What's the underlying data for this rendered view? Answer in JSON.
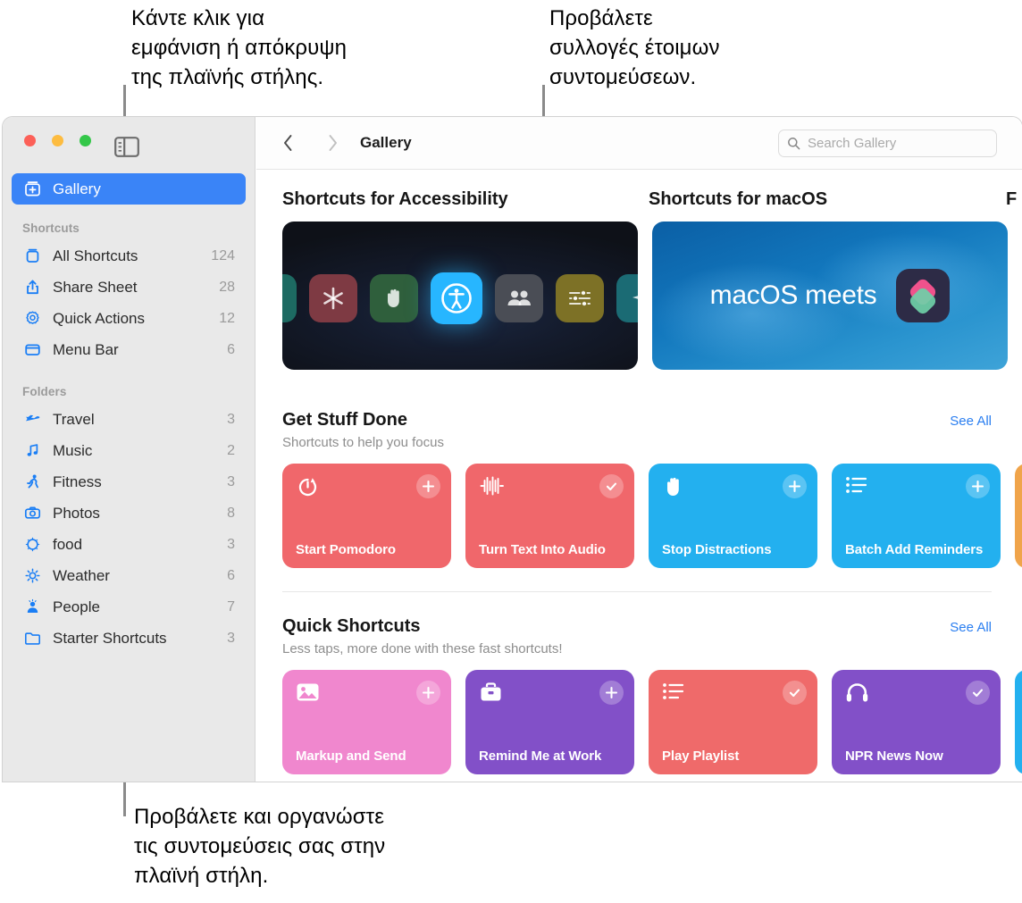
{
  "callouts": [
    {
      "id": "sidebar-toggle-callout",
      "text": "Κάντε κλικ για\nεμφάνιση ή απόκρυψη\nτης πλαϊνής στήλης."
    },
    {
      "id": "gallery-callout",
      "text": "Προβάλετε\nσυλλογές έτοιμων\nσυντομεύσεων."
    },
    {
      "id": "sidebar-callout",
      "text": "Προβάλετε και οργανώστε\nτις συντομεύσεις σας στην\nπλαϊνή στήλη."
    }
  ],
  "window": {
    "traffic_lights": [
      "close",
      "minimize",
      "zoom"
    ],
    "sidebar_toggle_icon": "sidebar-toggle-icon"
  },
  "sidebar": {
    "selected": {
      "label": "Gallery",
      "icon": "gallery-icon"
    },
    "groups": [
      {
        "label": "Shortcuts",
        "items": [
          {
            "label": "All Shortcuts",
            "count": "124",
            "icon": "shortcuts-icon"
          },
          {
            "label": "Share Sheet",
            "count": "28",
            "icon": "share-icon"
          },
          {
            "label": "Quick Actions",
            "count": "12",
            "icon": "gear-icon"
          },
          {
            "label": "Menu Bar",
            "count": "6",
            "icon": "menubar-icon"
          }
        ]
      },
      {
        "label": "Folders",
        "items": [
          {
            "label": "Travel",
            "count": "3",
            "icon": "airplane-icon"
          },
          {
            "label": "Music",
            "count": "2",
            "icon": "music-note-icon"
          },
          {
            "label": "Fitness",
            "count": "3",
            "icon": "running-person-icon"
          },
          {
            "label": "Photos",
            "count": "8",
            "icon": "camera-icon"
          },
          {
            "label": "food",
            "count": "3",
            "icon": "sparkle-circle-icon"
          },
          {
            "label": "Weather",
            "count": "6",
            "icon": "sun-icon"
          },
          {
            "label": "People",
            "count": "7",
            "icon": "person-icon"
          },
          {
            "label": "Starter Shortcuts",
            "count": "3",
            "icon": "folder-icon"
          }
        ]
      }
    ]
  },
  "toolbar": {
    "back_label": "‹",
    "forward_label": "›",
    "title": "Gallery",
    "search_placeholder": "Search Gallery",
    "search_value": ""
  },
  "banners": {
    "headings": [
      "Shortcuts for Accessibility",
      "Shortcuts for macOS",
      "F"
    ],
    "macos_text": "macOS meets",
    "accessibility_icons": [
      {
        "name": "magnifier-icon",
        "color": "#1d6a62"
      },
      {
        "name": "asterisk-icon",
        "color": "#7e3a43"
      },
      {
        "name": "hand-raised-icon",
        "color": "#2f5f3c"
      },
      {
        "name": "accessibility-icon",
        "color": "#27b6ff"
      },
      {
        "name": "people-icon",
        "color": "#4a4d55"
      },
      {
        "name": "sliders-icon",
        "color": "#7d7126"
      },
      {
        "name": "sparkles-icon",
        "color": "#1b6b74"
      }
    ]
  },
  "sections": [
    {
      "title": "Get Stuff Done",
      "subtitle": "Shortcuts to help you focus",
      "see_all": "See All",
      "cards": [
        {
          "title": "Start Pomodoro",
          "icon": "timer-icon",
          "badge": "plus",
          "color": "#f0676b"
        },
        {
          "title": "Turn Text Into Audio",
          "icon": "waveform-icon",
          "badge": "check",
          "color": "#f0676b"
        },
        {
          "title": "Stop Distractions",
          "icon": "hand-raised-icon",
          "badge": "plus",
          "color": "#23b0ef"
        },
        {
          "title": "Batch Add Reminders",
          "icon": "list-icon",
          "badge": "plus",
          "color": "#23b0ef"
        },
        {
          "title": "",
          "icon": "",
          "badge": "",
          "color": "#f0a44a"
        }
      ]
    },
    {
      "title": "Quick Shortcuts",
      "subtitle": "Less taps, more done with these fast shortcuts!",
      "see_all": "See All",
      "cards": [
        {
          "title": "Markup and Send",
          "icon": "photo-icon",
          "badge": "plus",
          "color": "#f087ce"
        },
        {
          "title": "Remind Me at Work",
          "icon": "briefcase-icon",
          "badge": "plus",
          "color": "#8250c8"
        },
        {
          "title": "Play Playlist",
          "icon": "list-icon",
          "badge": "check",
          "color": "#ef6a6a"
        },
        {
          "title": "NPR News Now",
          "icon": "headphones-icon",
          "badge": "check",
          "color": "#8250c8"
        },
        {
          "title": "",
          "icon": "",
          "badge": "",
          "color": "#23b0ef"
        }
      ]
    }
  ],
  "colors": {
    "accent": "#3a84f7",
    "link": "#2a7ef0",
    "sidebar_bg": "#e9e9e9",
    "muted_text": "#9b9b9b"
  }
}
